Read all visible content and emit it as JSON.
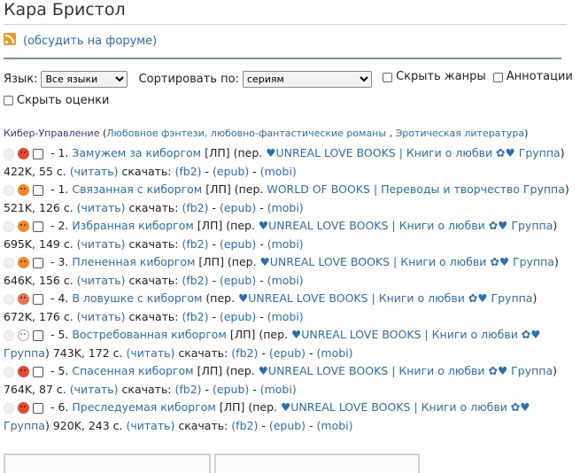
{
  "author": {
    "name": "Кара Бристол"
  },
  "forum_link": "(обсудить на форуме)",
  "controls": {
    "lang_label": "Язык:",
    "lang_value": "Все языки",
    "sort_label": "Сортировать по:",
    "sort_value": "сериям",
    "hide_genres": "Скрыть жанры",
    "annotations": "Аннотации",
    "hide_ratings": "Скрыть оценки"
  },
  "series": {
    "name": "Кибер-Управление",
    "open": " (",
    "genre1": "Любовное фэнтези, любовно-фантастические романы",
    "comma": " , ",
    "genre2": "Эротическая литература",
    "close": ")"
  },
  "books": [
    {
      "face": "red",
      "num": " - 1. ",
      "title": "Замужем за киборгом",
      "tag": " [ЛП] (пер. ",
      "translator": "♥UNREAL LOVE BOOKS | Книги о любви ✿♥ Группа",
      "close": ")",
      "size": "422K, 55 с. ",
      "read": "(читать)",
      "download": " скачать: ",
      "fb2": "(fb2)",
      "dash1": " - ",
      "epub": "(epub)",
      "dash2": " - ",
      "mobi": "(mobi)"
    },
    {
      "face": "orange",
      "num": " - 1. ",
      "title": "Связанная с киборгом",
      "tag": " [ЛП] (пер. ",
      "translator": "WORLD OF BOOKS | Переводы и творчество Группа",
      "close": ")",
      "size": "521K, 126 с. ",
      "read": "(читать)",
      "download": " скачать: ",
      "fb2": "(fb2)",
      "dash1": " - ",
      "epub": "(epub)",
      "dash2": " - ",
      "mobi": "(mobi)"
    },
    {
      "face": "orange",
      "num": " - 2. ",
      "title": "Избранная киборгом",
      "tag": " [ЛП] (пер. ",
      "translator": "♥UNREAL LOVE BOOKS | Книги о любви ✿♥ Группа",
      "close": ")",
      "size": "695K, 149 с. ",
      "read": "(читать)",
      "download": " скачать: ",
      "fb2": "(fb2)",
      "dash1": " - ",
      "epub": "(epub)",
      "dash2": " - ",
      "mobi": "(mobi)"
    },
    {
      "face": "orange",
      "num": " - 3. ",
      "title": "Плененная киборгом",
      "tag": " [ЛП] (пер. ",
      "translator": "♥UNREAL LOVE BOOKS | Книги о любви ✿♥ Группа",
      "close": ")",
      "size": "646K, 156 с. ",
      "read": "(читать)",
      "download": " скачать: ",
      "fb2": "(fb2)",
      "dash1": " - ",
      "epub": "(epub)",
      "dash2": " - ",
      "mobi": "(mobi)"
    },
    {
      "face": "pink",
      "num": " - 4. ",
      "title": "В ловушке с киборгом",
      "tag": " (пер. ",
      "translator": "♥UNREAL LOVE BOOKS | Книги о любви ✿♥ Группа",
      "close": ")",
      "size": "672K, 176 с. ",
      "read": "(читать)",
      "download": " скачать: ",
      "fb2": "(fb2)",
      "dash1": " - ",
      "epub": "(epub)",
      "dash2": " - ",
      "mobi": "(mobi)"
    },
    {
      "face": "empty",
      "num": " - 5. ",
      "title": "Востребованная киборгом",
      "tag": " [ЛП] (пер. ",
      "translator": "♥UNREAL LOVE BOOKS | Книги о любви ✿♥ Группа",
      "close": ")",
      "size": " 743K, 172 с. ",
      "read": "(читать)",
      "download": " скачать: ",
      "fb2": "(fb2)",
      "dash1": " - ",
      "epub": "(epub)",
      "dash2": " - ",
      "mobi": "(mobi)"
    },
    {
      "face": "red",
      "num": " - 5. ",
      "title": "Спасенная киборгом",
      "tag": " [ЛП] (пер. ",
      "translator": "♥UNREAL LOVE BOOKS | Книги о любви ✿♥ Группа",
      "close": ")",
      "size": "764K, 87 с. ",
      "read": "(читать)",
      "download": " скачать: ",
      "fb2": "(fb2)",
      "dash1": " - ",
      "epub": "(epub)",
      "dash2": " - ",
      "mobi": "(mobi)"
    },
    {
      "face": "red",
      "num": " - 6. ",
      "title": "Преследуемая киборгом",
      "tag": " [ЛП] (пер. ",
      "translator": "♥UNREAL LOVE BOOKS | Книги о любви ✿♥ Группа",
      "close": ")",
      "size": " 920K, 243 с. ",
      "read": "(читать)",
      "download": " скачать: ",
      "fb2": "(fb2)",
      "dash1": " - ",
      "epub": "(epub)",
      "dash2": " - ",
      "mobi": "(mobi)"
    }
  ]
}
